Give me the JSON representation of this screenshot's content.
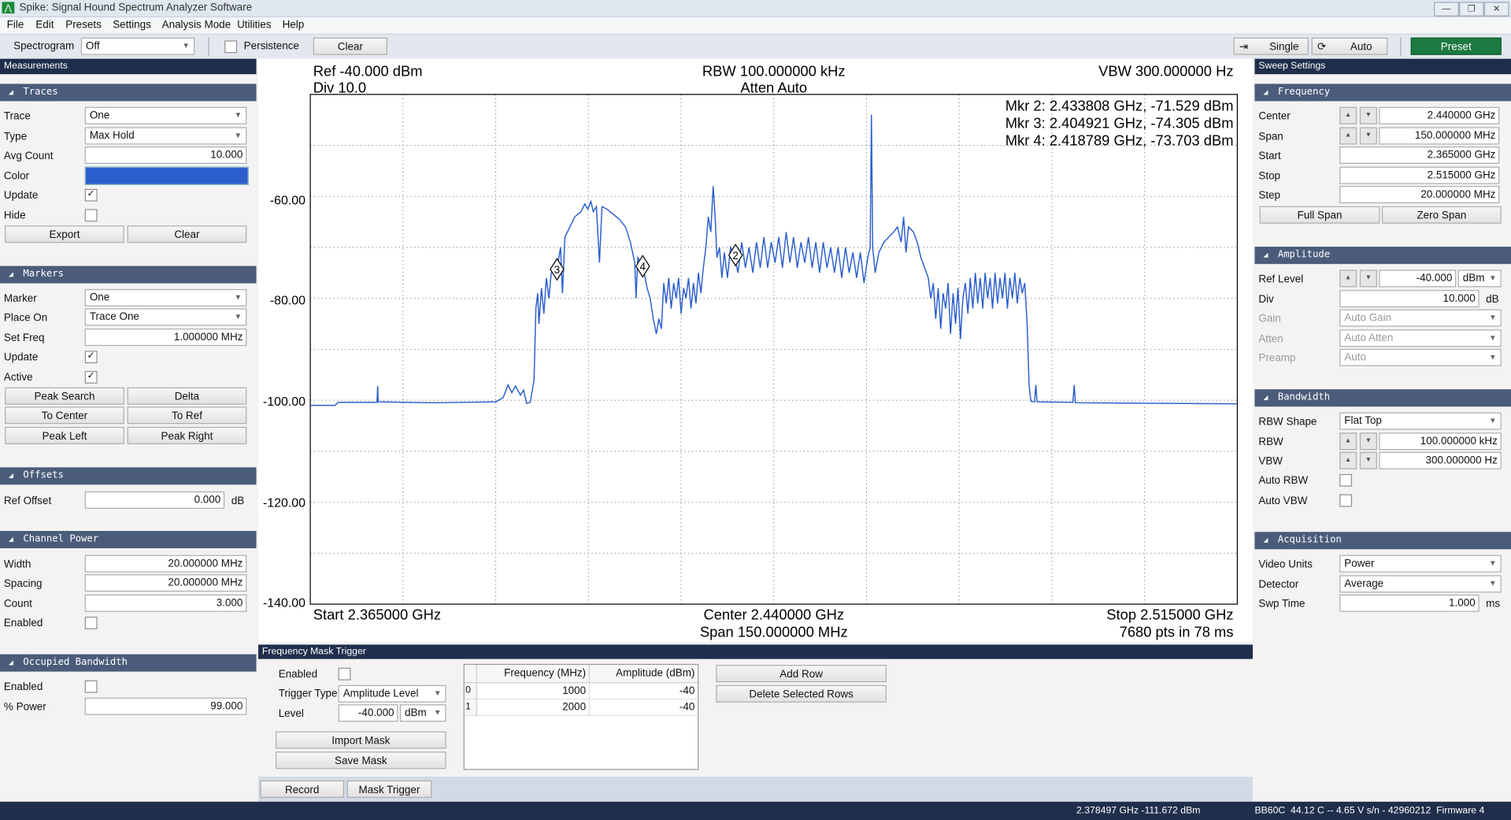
{
  "window": {
    "title": "Spike: Signal Hound Spectrum Analyzer Software",
    "minimize": "—",
    "restore": "❐",
    "close": "✕"
  },
  "menu": [
    "File",
    "Edit",
    "Presets",
    "Settings",
    "Analysis Mode",
    "Utilities",
    "Help"
  ],
  "toolbar": {
    "spectrogram_label": "Spectrogram",
    "spectrogram_value": "Off",
    "persistence_label": "Persistence",
    "persistence_checked": false,
    "clear_label": "Clear",
    "single_label": "Single",
    "auto_label": "Auto",
    "preset_label": "Preset",
    "preset_color": "#1b7a3f"
  },
  "left": {
    "title": "Measurements",
    "traces": {
      "title": "Traces",
      "trace_label": "Trace",
      "trace_value": "One",
      "type_label": "Type",
      "type_value": "Max Hold",
      "avg_label": "Avg Count",
      "avg_value": "10.000",
      "color_label": "Color",
      "color_value": "#2c5fcd",
      "update_label": "Update",
      "update_checked": true,
      "hide_label": "Hide",
      "hide_checked": false,
      "export_label": "Export",
      "clear_label": "Clear"
    },
    "markers": {
      "title": "Markers",
      "marker_label": "Marker",
      "marker_value": "One",
      "place_label": "Place On",
      "place_value": "Trace One",
      "setfreq_label": "Set Freq",
      "setfreq_value": "1.000000 MHz",
      "update_label": "Update",
      "update_checked": true,
      "active_label": "Active",
      "active_checked": true,
      "buttons": [
        "Peak Search",
        "Delta",
        "To Center",
        "To Ref",
        "Peak Left",
        "Peak Right"
      ]
    },
    "offsets": {
      "title": "Offsets",
      "ref_label": "Ref Offset",
      "ref_value": "0.000",
      "ref_unit": "dB"
    },
    "channel_power": {
      "title": "Channel Power",
      "width_label": "Width",
      "width_value": "20.000000 MHz",
      "spacing_label": "Spacing",
      "spacing_value": "20.000000 MHz",
      "count_label": "Count",
      "count_value": "3.000",
      "enabled_label": "Enabled",
      "enabled_checked": false
    },
    "occupied_bw": {
      "title": "Occupied Bandwidth",
      "enabled_label": "Enabled",
      "enabled_checked": false,
      "power_label": "% Power",
      "power_value": "99.000"
    }
  },
  "right": {
    "title": "Sweep Settings",
    "frequency": {
      "title": "Frequency",
      "center_label": "Center",
      "center_value": "2.440000 GHz",
      "span_label": "Span",
      "span_value": "150.000000 MHz",
      "start_label": "Start",
      "start_value": "2.365000 GHz",
      "stop_label": "Stop",
      "stop_value": "2.515000 GHz",
      "step_label": "Step",
      "step_value": "20.000000 MHz",
      "full_span": "Full Span",
      "zero_span": "Zero Span"
    },
    "amplitude": {
      "title": "Amplitude",
      "ref_label": "Ref Level",
      "ref_value": "-40.000",
      "ref_unit": "dBm",
      "div_label": "Div",
      "div_value": "10.000",
      "div_unit": "dB",
      "gain_label": "Gain",
      "gain_value": "Auto Gain",
      "atten_label": "Atten",
      "atten_value": "Auto Atten",
      "preamp_label": "Preamp",
      "preamp_value": "Auto"
    },
    "bandwidth": {
      "title": "Bandwidth",
      "shape_label": "RBW Shape",
      "shape_value": "Flat Top",
      "rbw_label": "RBW",
      "rbw_value": "100.000000 kHz",
      "vbw_label": "VBW",
      "vbw_value": "300.000000 Hz",
      "auto_rbw_label": "Auto RBW",
      "auto_rbw_checked": false,
      "auto_vbw_label": "Auto VBW",
      "auto_vbw_checked": false
    },
    "acquisition": {
      "title": "Acquisition",
      "units_label": "Video Units",
      "units_value": "Power",
      "detector_label": "Detector",
      "detector_value": "Average",
      "swp_label": "Swp Time",
      "swp_value": "1.000",
      "swp_unit": "ms"
    }
  },
  "plot": {
    "ref": "Ref -40.000 dBm",
    "div": "Div 10.0",
    "rbw": "RBW 100.000000 kHz",
    "atten": "Atten Auto",
    "vbw": "VBW 300.000000 Hz",
    "markers_text": [
      "Mkr 2: 2.433808 GHz, -71.529 dBm",
      "Mkr 3: 2.404921 GHz, -74.305 dBm",
      "Mkr 4: 2.418789 GHz, -73.703 dBm"
    ],
    "start": "Start 2.365000 GHz",
    "center": "Center 2.440000 GHz",
    "span": "Span 150.000000 MHz",
    "stop": "Stop 2.515000 GHz",
    "pts": "7680 pts in 78 ms"
  },
  "chart_data": {
    "type": "line",
    "xlabel": "",
    "ylabel": "",
    "xlim": [
      2.365,
      2.515
    ],
    "ylim": [
      -140,
      -40
    ],
    "x_divisions": 10,
    "y_divisions": 10,
    "grid": true,
    "yticks": [
      "-60.00",
      "-80.00",
      "-100.00",
      "-120.00",
      "-140.00"
    ],
    "ytick_values": [
      -60,
      -80,
      -100,
      -120,
      -140
    ],
    "trace_color": "#2c5fcd",
    "series": [
      {
        "points": [
          [
            2.365,
            -101
          ],
          [
            2.369,
            -101
          ],
          [
            2.3695,
            -100.4
          ],
          [
            2.3758,
            -100.4
          ],
          [
            2.3759,
            -97.2
          ],
          [
            2.376,
            -100.3
          ],
          [
            2.385,
            -100.5
          ],
          [
            2.395,
            -100.3
          ],
          [
            2.3962,
            -99.5
          ],
          [
            2.397,
            -97
          ],
          [
            2.3976,
            -98.5
          ],
          [
            2.3982,
            -97.2
          ],
          [
            2.399,
            -99
          ],
          [
            2.3995,
            -98
          ],
          [
            2.4,
            -100.6
          ],
          [
            2.4006,
            -100.4
          ],
          [
            2.4012,
            -96
          ],
          [
            2.4015,
            -82
          ],
          [
            2.4018,
            -79
          ],
          [
            2.402,
            -85
          ],
          [
            2.4024,
            -78
          ],
          [
            2.4028,
            -83
          ],
          [
            2.4032,
            -76
          ],
          [
            2.4036,
            -80
          ],
          [
            2.404,
            -75
          ],
          [
            2.4049,
            -74.3
          ],
          [
            2.4055,
            -70
          ],
          [
            2.4058,
            -79
          ],
          [
            2.4062,
            -68
          ],
          [
            2.407,
            -66
          ],
          [
            2.4078,
            -64
          ],
          [
            2.4088,
            -63
          ],
          [
            2.4094,
            -61.5
          ],
          [
            2.4099,
            -62.5
          ],
          [
            2.4104,
            -61
          ],
          [
            2.4108,
            -63
          ],
          [
            2.4113,
            -62
          ],
          [
            2.4118,
            -73
          ],
          [
            2.4122,
            -62
          ],
          [
            2.413,
            -62.5
          ],
          [
            2.414,
            -63.5
          ],
          [
            2.415,
            -64.5
          ],
          [
            2.416,
            -66
          ],
          [
            2.4168,
            -69
          ],
          [
            2.4175,
            -73
          ],
          [
            2.4177,
            -80
          ],
          [
            2.418,
            -72
          ],
          [
            2.4188,
            -73.7
          ],
          [
            2.4195,
            -78
          ],
          [
            2.42,
            -80
          ],
          [
            2.4205,
            -84
          ],
          [
            2.421,
            -87
          ],
          [
            2.4214,
            -84
          ],
          [
            2.4218,
            -86
          ],
          [
            2.4222,
            -77
          ],
          [
            2.4226,
            -81
          ],
          [
            2.423,
            -76
          ],
          [
            2.4234,
            -82
          ],
          [
            2.4238,
            -77
          ],
          [
            2.4242,
            -80
          ],
          [
            2.4246,
            -76
          ],
          [
            2.425,
            -83
          ],
          [
            2.4254,
            -78
          ],
          [
            2.4258,
            -80
          ],
          [
            2.4262,
            -76
          ],
          [
            2.4266,
            -82
          ],
          [
            2.427,
            -77
          ],
          [
            2.4274,
            -81
          ],
          [
            2.4278,
            -75
          ],
          [
            2.4282,
            -79
          ],
          [
            2.4286,
            -74
          ],
          [
            2.429,
            -70
          ],
          [
            2.4294,
            -64
          ],
          [
            2.4298,
            -67
          ],
          [
            2.4302,
            -58
          ],
          [
            2.4305,
            -64
          ],
          [
            2.4308,
            -72
          ],
          [
            2.4312,
            -70
          ],
          [
            2.4316,
            -76
          ],
          [
            2.432,
            -71
          ],
          [
            2.4325,
            -76
          ],
          [
            2.433,
            -70
          ],
          [
            2.4336,
            -71.5
          ],
          [
            2.4342,
            -75
          ],
          [
            2.4348,
            -69
          ],
          [
            2.4354,
            -74
          ],
          [
            2.436,
            -70
          ],
          [
            2.4366,
            -75
          ],
          [
            2.4372,
            -69
          ],
          [
            2.4378,
            -74
          ],
          [
            2.4384,
            -68
          ],
          [
            2.439,
            -74
          ],
          [
            2.4396,
            -69
          ],
          [
            2.4402,
            -73
          ],
          [
            2.4408,
            -68
          ],
          [
            2.4414,
            -74
          ],
          [
            2.442,
            -67
          ],
          [
            2.4426,
            -73
          ],
          [
            2.4432,
            -68
          ],
          [
            2.4438,
            -74
          ],
          [
            2.4444,
            -69
          ],
          [
            2.445,
            -73
          ],
          [
            2.4456,
            -68
          ],
          [
            2.4462,
            -74
          ],
          [
            2.4468,
            -69
          ],
          [
            2.4474,
            -75
          ],
          [
            2.448,
            -69
          ],
          [
            2.4486,
            -74
          ],
          [
            2.4492,
            -70
          ],
          [
            2.4498,
            -75
          ],
          [
            2.4504,
            -70
          ],
          [
            2.451,
            -76
          ],
          [
            2.4516,
            -70
          ],
          [
            2.4522,
            -75
          ],
          [
            2.4528,
            -71
          ],
          [
            2.4534,
            -76
          ],
          [
            2.454,
            -71
          ],
          [
            2.4546,
            -77
          ],
          [
            2.4552,
            -72
          ],
          [
            2.4556,
            -70
          ],
          [
            2.4558,
            -44
          ],
          [
            2.456,
            -70
          ],
          [
            2.4564,
            -75
          ],
          [
            2.457,
            -71
          ],
          [
            2.4578,
            -69
          ],
          [
            2.4586,
            -68
          ],
          [
            2.4594,
            -67
          ],
          [
            2.46,
            -66
          ],
          [
            2.4606,
            -69
          ],
          [
            2.461,
            -64
          ],
          [
            2.4614,
            -71
          ],
          [
            2.4618,
            -66
          ],
          [
            2.4626,
            -67
          ],
          [
            2.4632,
            -69
          ],
          [
            2.4638,
            -72
          ],
          [
            2.4644,
            -74
          ],
          [
            2.465,
            -76
          ],
          [
            2.4654,
            -80
          ],
          [
            2.4658,
            -77
          ],
          [
            2.4662,
            -84
          ],
          [
            2.4666,
            -78
          ],
          [
            2.467,
            -86
          ],
          [
            2.4674,
            -79
          ],
          [
            2.4678,
            -82
          ],
          [
            2.4682,
            -77
          ],
          [
            2.4686,
            -87
          ],
          [
            2.469,
            -79
          ],
          [
            2.4694,
            -85
          ],
          [
            2.4698,
            -78
          ],
          [
            2.4702,
            -88
          ],
          [
            2.4706,
            -80
          ],
          [
            2.471,
            -77
          ],
          [
            2.4714,
            -83
          ],
          [
            2.4718,
            -76
          ],
          [
            2.4722,
            -82
          ],
          [
            2.4726,
            -75
          ],
          [
            2.473,
            -81
          ],
          [
            2.4734,
            -76
          ],
          [
            2.4738,
            -82
          ],
          [
            2.4742,
            -75
          ],
          [
            2.4746,
            -80
          ],
          [
            2.475,
            -76
          ],
          [
            2.4754,
            -82
          ],
          [
            2.4758,
            -75
          ],
          [
            2.4762,
            -81
          ],
          [
            2.4766,
            -76
          ],
          [
            2.477,
            -80
          ],
          [
            2.4774,
            -75
          ],
          [
            2.4778,
            -82
          ],
          [
            2.4782,
            -76
          ],
          [
            2.4786,
            -80
          ],
          [
            2.479,
            -75
          ],
          [
            2.4794,
            -81
          ],
          [
            2.4798,
            -76
          ],
          [
            2.4802,
            -79
          ],
          [
            2.4806,
            -77
          ],
          [
            2.481,
            -85
          ],
          [
            2.4813,
            -97
          ],
          [
            2.4816,
            -100.2
          ],
          [
            2.4822,
            -100.3
          ],
          [
            2.4824,
            -97
          ],
          [
            2.4826,
            -100.3
          ],
          [
            2.4884,
            -100.4
          ],
          [
            2.4886,
            -97
          ],
          [
            2.4888,
            -100.5
          ],
          [
            2.515,
            -100.7
          ]
        ]
      }
    ],
    "markers": [
      {
        "label": "2",
        "x": 2.433808,
        "y": -71.529
      },
      {
        "label": "3",
        "x": 2.404921,
        "y": -74.305
      },
      {
        "label": "4",
        "x": 2.418789,
        "y": -73.703
      }
    ]
  },
  "mask_trigger": {
    "title": "Frequency Mask Trigger",
    "enabled_label": "Enabled",
    "enabled_checked": false,
    "trigger_type_label": "Trigger Type",
    "trigger_type_value": "Amplitude Level",
    "level_label": "Level",
    "level_value": "-40.000",
    "level_unit": "dBm",
    "import_label": "Import Mask",
    "save_label": "Save Mask",
    "columns": [
      "Frequency (MHz)",
      "Amplitude (dBm)"
    ],
    "rows": [
      {
        "index": "0",
        "freq": "1000",
        "amp": "-40"
      },
      {
        "index": "1",
        "freq": "2000",
        "amp": "-40"
      }
    ],
    "add_row": "Add Row",
    "delete_rows": "Delete Selected Rows"
  },
  "tabs": [
    "Record",
    "Mask Trigger"
  ],
  "status": {
    "cursor": "2.378497 GHz -111.672 dBm",
    "device": "BB60C  44.12 C -- 4.65 V s/n - 42960212  Firmware 4"
  }
}
